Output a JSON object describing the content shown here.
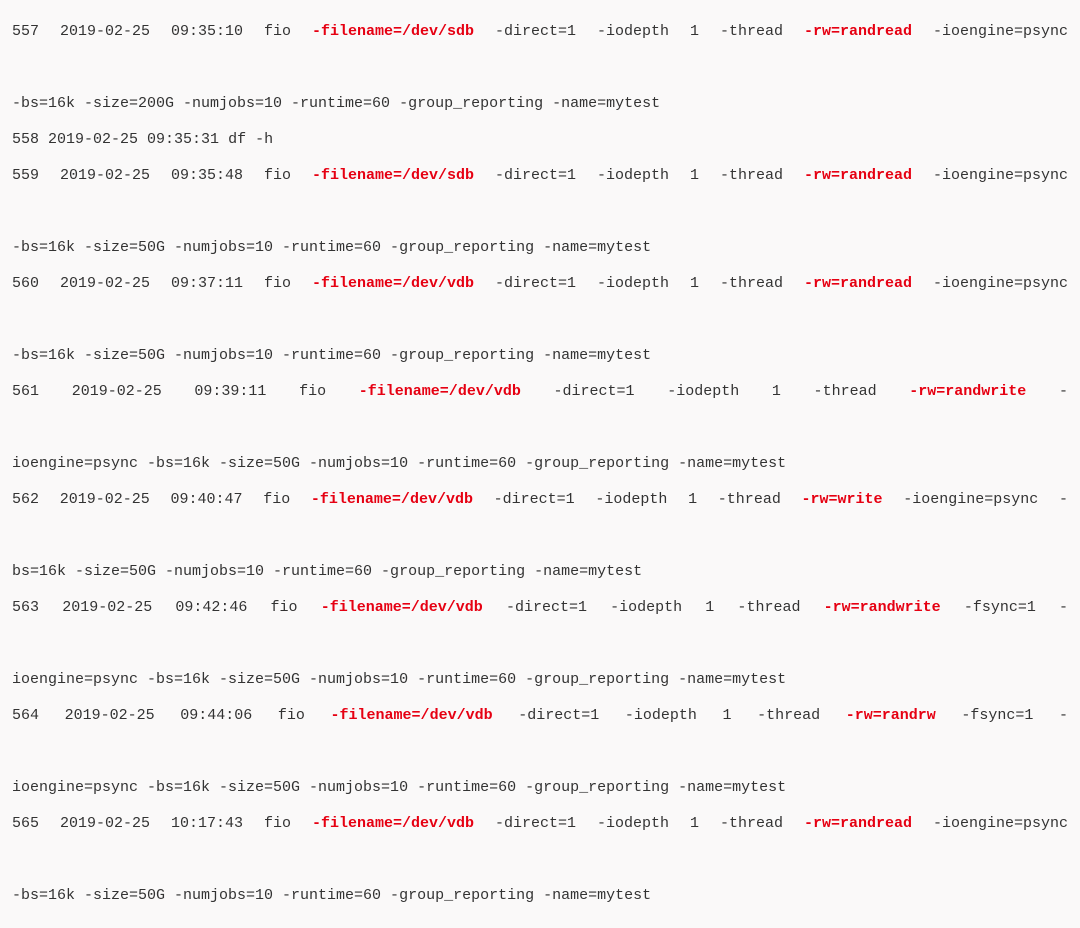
{
  "entries": [
    {
      "num": "557",
      "ts": "2019-02-25 09:35:10",
      "cmd": "fio",
      "parts": [
        {
          "type": "red",
          "text": "-filename=/dev/sdb"
        },
        {
          "type": "plain",
          "text": "-direct=1 -iodepth 1 -thread"
        },
        {
          "type": "red",
          "text": "-rw=randread"
        },
        {
          "type": "plain",
          "text": "-ioengine=psync"
        }
      ],
      "cont": "-bs=16k -size=200G -numjobs=10 -runtime=60 -group_reporting -name=mytest",
      "justify": true
    },
    {
      "num": "558",
      "ts": "2019-02-25 09:35:31",
      "cmd": "df -h",
      "parts": [],
      "cont": null,
      "justify": false
    },
    {
      "num": "559",
      "ts": "2019-02-25 09:35:48",
      "cmd": "fio",
      "parts": [
        {
          "type": "red",
          "text": "-filename=/dev/sdb"
        },
        {
          "type": "plain",
          "text": "-direct=1 -iodepth 1 -thread"
        },
        {
          "type": "red",
          "text": "-rw=randread"
        },
        {
          "type": "plain",
          "text": "-ioengine=psync"
        }
      ],
      "cont": "-bs=16k -size=50G -numjobs=10 -runtime=60 -group_reporting -name=mytest",
      "justify": true
    },
    {
      "num": "560",
      "ts": "2019-02-25 09:37:11",
      "cmd": "fio",
      "parts": [
        {
          "type": "red",
          "text": "-filename=/dev/vdb"
        },
        {
          "type": "plain",
          "text": "-direct=1 -iodepth 1 -thread"
        },
        {
          "type": "red",
          "text": "-rw=randread"
        },
        {
          "type": "plain",
          "text": "-ioengine=psync"
        }
      ],
      "cont": "-bs=16k -size=50G -numjobs=10 -runtime=60 -group_reporting -name=mytest",
      "justify": true
    },
    {
      "num": "561",
      "ts": "2019-02-25 09:39:11",
      "cmd": "fio",
      "parts": [
        {
          "type": "red",
          "text": "-filename=/dev/vdb"
        },
        {
          "type": "plain",
          "text": "-direct=1 -iodepth 1 -thread"
        },
        {
          "type": "red",
          "text": "-rw=randwrite"
        },
        {
          "type": "plain",
          "text": "-"
        }
      ],
      "cont": "ioengine=psync -bs=16k -size=50G -numjobs=10 -runtime=60 -group_reporting -name=mytest",
      "justify": true
    },
    {
      "num": "562",
      "ts": "2019-02-25 09:40:47",
      "cmd": "fio",
      "parts": [
        {
          "type": "red",
          "text": "-filename=/dev/vdb"
        },
        {
          "type": "plain",
          "text": "-direct=1 -iodepth 1 -thread"
        },
        {
          "type": "red",
          "text": "-rw=write"
        },
        {
          "type": "plain",
          "text": "-ioengine=psync -"
        }
      ],
      "cont": "bs=16k -size=50G -numjobs=10 -runtime=60 -group_reporting -name=mytest",
      "justify": true
    },
    {
      "num": "563",
      "ts": "2019-02-25 09:42:46",
      "cmd": "fio",
      "parts": [
        {
          "type": "red",
          "text": "-filename=/dev/vdb"
        },
        {
          "type": "plain",
          "text": "-direct=1 -iodepth 1 -thread"
        },
        {
          "type": "red",
          "text": "-rw=randwrite"
        },
        {
          "type": "plain",
          "text": "-fsync=1 -"
        }
      ],
      "cont": "ioengine=psync -bs=16k -size=50G -numjobs=10 -runtime=60 -group_reporting -name=mytest",
      "justify": true
    },
    {
      "num": "564",
      "ts": "2019-02-25 09:44:06",
      "cmd": "fio",
      "parts": [
        {
          "type": "red",
          "text": "-filename=/dev/vdb"
        },
        {
          "type": "plain",
          "text": "-direct=1 -iodepth 1 -thread"
        },
        {
          "type": "red",
          "text": "-rw=randrw"
        },
        {
          "type": "plain",
          "text": "-fsync=1 -"
        }
      ],
      "cont": "ioengine=psync -bs=16k -size=50G -numjobs=10 -runtime=60 -group_reporting -name=mytest",
      "justify": true
    },
    {
      "num": "565",
      "ts": "2019-02-25 10:17:43",
      "cmd": "fio",
      "parts": [
        {
          "type": "red",
          "text": "-filename=/dev/vdb"
        },
        {
          "type": "plain",
          "text": "-direct=1 -iodepth 1 -thread"
        },
        {
          "type": "red",
          "text": "-rw=randread"
        },
        {
          "type": "plain",
          "text": "-ioengine=psync"
        }
      ],
      "cont": "-bs=16k -size=50G -numjobs=10 -runtime=60 -group_reporting -name=mytest",
      "justify": true
    }
  ]
}
